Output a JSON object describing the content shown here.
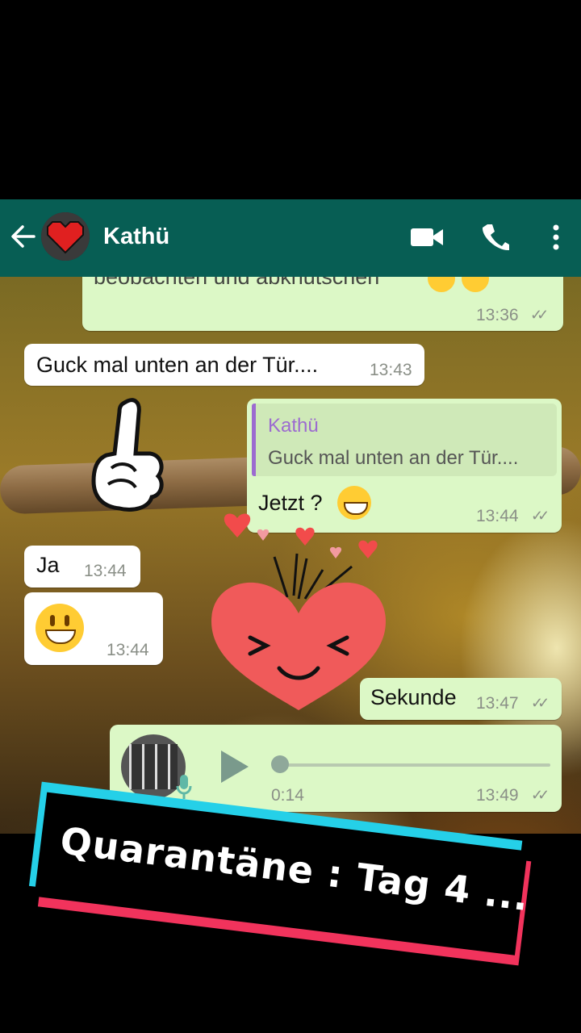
{
  "header": {
    "contact_name": "Kathü",
    "back_icon": "arrow-left-icon",
    "video_icon": "video-call-icon",
    "call_icon": "phone-icon",
    "menu_icon": "more-vertical-icon",
    "bg_color": "#075e54"
  },
  "messages": [
    {
      "dir": "out",
      "text": "beobachten und abknutschen",
      "time": "13:36",
      "status": "read"
    },
    {
      "dir": "in",
      "text": "Guck mal unten an der Tür....",
      "time": "13:43"
    },
    {
      "dir": "out",
      "quote_author": "Kathü",
      "quote_text": "Guck mal unten an der Tür....",
      "text": "Jetzt ?",
      "time": "13:44",
      "status": "read"
    },
    {
      "dir": "in",
      "text": "Ja",
      "time": "13:44"
    },
    {
      "dir": "in",
      "emoji": "grinning-face",
      "time": "13:44"
    },
    {
      "dir": "out",
      "text": "Sekunde",
      "time": "13:47",
      "status": "read"
    },
    {
      "dir": "out",
      "type": "voice",
      "duration": "0:14",
      "time": "13:49",
      "status": "read"
    }
  ],
  "overlay": {
    "banner_text": "Quarantäne :  Tag 4 ...",
    "colors": {
      "cyan": "#25d0e8",
      "pink": "#f1335c",
      "text": "#ffffff"
    }
  },
  "colors": {
    "bubble_out": "#dcf8c6",
    "bubble_in": "#ffffff",
    "time": "#8a8f87",
    "quote_bar": "#9c6bd0"
  }
}
